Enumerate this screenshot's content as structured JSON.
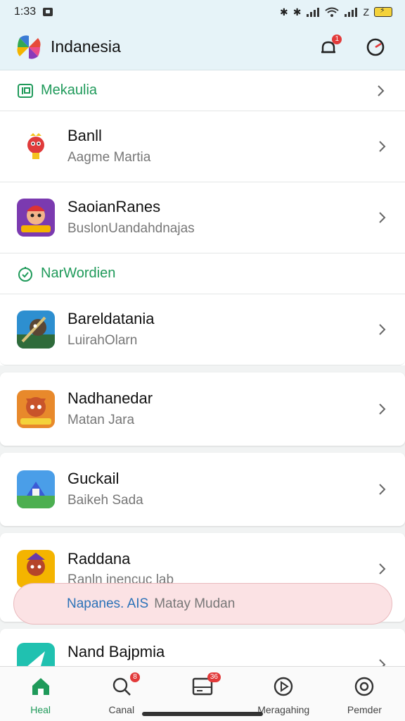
{
  "status_bar": {
    "time": "1:33",
    "network": "Z"
  },
  "header": {
    "title": "Indanesia",
    "notification_count": "1"
  },
  "sections": [
    {
      "label": "Mekaulia",
      "items": [
        {
          "title": "Banll",
          "subtitle": "Aagme Martia",
          "icon": "toy-mascot-icon"
        },
        {
          "title": "SaoianRanes",
          "subtitle": "BuslonUandahdnajas",
          "icon": "game-cartoon-icon"
        }
      ]
    },
    {
      "label": "NarWordien",
      "items": [
        {
          "title": "Bareldatania",
          "subtitle": "LuirahOlarn",
          "icon": "game-pirate-icon"
        }
      ]
    }
  ],
  "cards": [
    {
      "title": "Nadhanedar",
      "subtitle": "Matan Jara",
      "icon": "game-fox-icon"
    },
    {
      "title": "Guckail",
      "subtitle": "Baikeh Sada",
      "icon": "game-house-icon"
    },
    {
      "title": "Raddana",
      "subtitle": "Ranln inencuc lab",
      "icon": "game-warrior-icon"
    },
    {
      "title": "Nand Bajpmia",
      "subtitle": "",
      "icon": "play-app-icon"
    }
  ],
  "toast": {
    "highlight": "Napanes. AIS",
    "text": "Matay Mudan"
  },
  "bottom_nav": [
    {
      "label": "Heal",
      "icon": "home-icon",
      "badge": ""
    },
    {
      "label": "Canal",
      "icon": "search-icon",
      "badge": "8"
    },
    {
      "label": "",
      "icon": "inbox-icon",
      "badge": "36"
    },
    {
      "label": "Meragahing",
      "icon": "play-circle-icon",
      "badge": ""
    },
    {
      "label": "Pemder",
      "icon": "profile-icon",
      "badge": ""
    }
  ],
  "colors": {
    "accent": "#1f9a5a",
    "header_bg": "#e6f3f8",
    "badge": "#e23a3a",
    "toast_bg": "#fbe2e4"
  }
}
